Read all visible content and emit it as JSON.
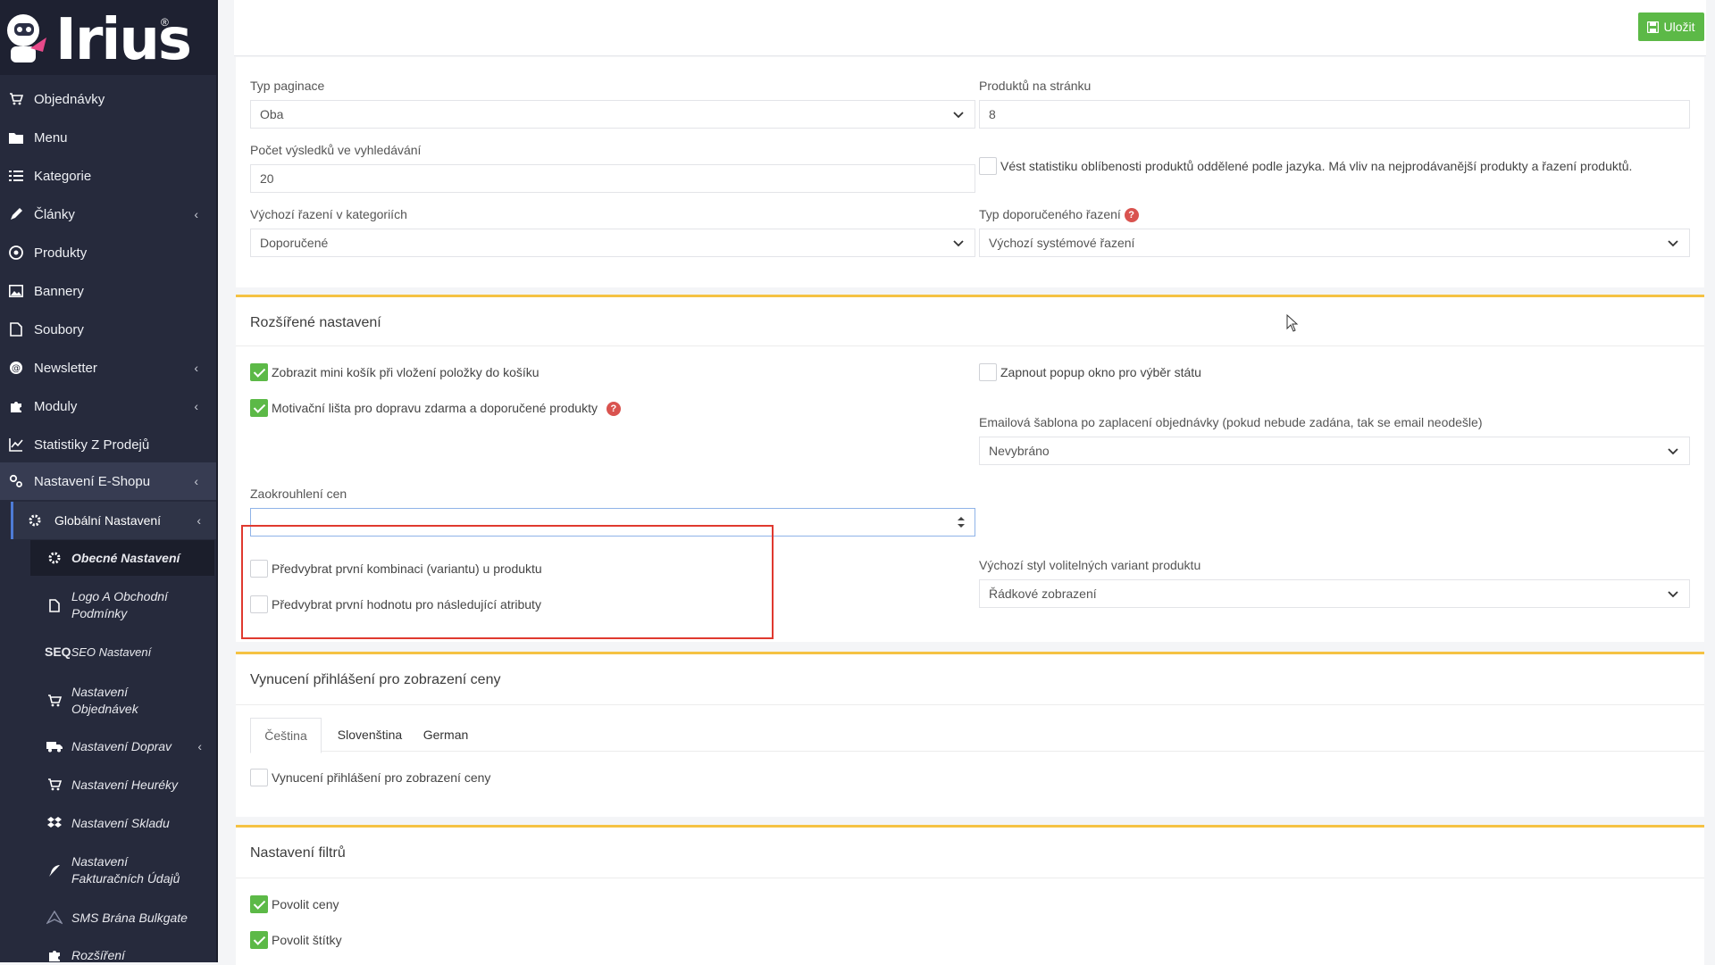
{
  "brand": {
    "name": "Irius",
    "reg": "®"
  },
  "sidebar": {
    "items": [
      {
        "label": "Objednávky",
        "icon": "cart-icon"
      },
      {
        "label": "Menu",
        "icon": "folder-icon"
      },
      {
        "label": "Kategorie",
        "icon": "list-icon"
      },
      {
        "label": "Články",
        "icon": "pencil-icon",
        "chevron": "‹"
      },
      {
        "label": "Produkty",
        "icon": "aperture-icon"
      },
      {
        "label": "Bannery",
        "icon": "image-icon"
      },
      {
        "label": "Soubory",
        "icon": "file-icon"
      },
      {
        "label": "Newsletter",
        "icon": "mail-icon",
        "chevron": "‹"
      },
      {
        "label": "Moduly",
        "icon": "puzzle-icon",
        "chevron": "‹"
      },
      {
        "label": "Statistiky Z Prodejů",
        "icon": "chart-icon"
      },
      {
        "label": "Nastavení E-Shopu",
        "icon": "settings-icon",
        "chevron": "‹"
      }
    ],
    "sub": {
      "label": "Globální Nastavení",
      "chevron": "‹"
    },
    "sub2": [
      {
        "label": "Obecné Nastavení",
        "icon": "gear-icon"
      },
      {
        "label": "Logo A Obchodní Podmínky",
        "icon": "file-icon"
      },
      {
        "label": "SEO Nastavení",
        "icon": "seo-icon",
        "icon_text": "SEQ"
      },
      {
        "label": "Nastavení Objednávek",
        "icon": "cart-icon"
      },
      {
        "label": "Nastavení Doprav",
        "icon": "truck-icon",
        "chevron": "‹"
      },
      {
        "label": "Nastavení Heuréky",
        "icon": "cart-icon"
      },
      {
        "label": "Nastavení Skladu",
        "icon": "dropbox-icon"
      },
      {
        "label": "Nastavení Fakturačních Údajů",
        "icon": "feather-icon"
      },
      {
        "label": "SMS Brána Bulkgate",
        "icon": "paperplane-icon"
      },
      {
        "label": "Rozšíření",
        "icon": "puzzle-icon"
      }
    ]
  },
  "toolbar": {
    "save_label": "Uložit"
  },
  "general": {
    "pagination_label": "Typ paginace",
    "pagination_value": "Oba",
    "per_page_label": "Produktů na stránku",
    "per_page_value": "8",
    "search_results_label": "Počet výsledků ve vyhledávání",
    "search_results_value": "20",
    "stats_text": "Vést statistiku oblíbenosti produktů oddělené podle jazyka. Má vliv na nejprodávanější produkty a řazení produktů.",
    "sort_label": "Výchozí řazení v kategoriích",
    "sort_value": "Doporučené",
    "rec_sort_label": "Typ doporučeného řazení",
    "rec_sort_value": "Výchozí systémové řazení"
  },
  "advanced": {
    "title": "Rozšířené nastavení",
    "mini_cart": "Zobrazit mini košík při vložení položky do košíku",
    "motivation": "Motivační lišta pro dopravu zdarma a doporučené produkty",
    "popup": "Zapnout popup okno pro výběr státu",
    "email_tpl_label": "Emailová šablona po zaplacení objednávky (pokud nebude zadána, tak se email neodešle)",
    "email_tpl_value": "Nevybráno",
    "rounding_label": "Zaokrouhlení cen",
    "rounding_value": "",
    "preselect_combination": "Předvybrat první kombinaci (variantu) u produktu",
    "preselect_value": "Předvybrat první hodnotu pro následující atributy",
    "variant_style_label": "Výchozí styl volitelných variant produktu",
    "variant_style_value": "Řádkové zobrazení"
  },
  "login": {
    "title": "Vynucení přihlášení pro zobrazení ceny",
    "tabs": [
      "Čeština",
      "Slovenština",
      "German"
    ],
    "checkbox": "Vynucení přihlášení pro zobrazení ceny"
  },
  "filters": {
    "title": "Nastavení filtrů",
    "prices": "Povolit ceny",
    "tags": "Povolit štítky"
  },
  "colors": {
    "accent": "#f5c243",
    "success": "#5cb947",
    "sidebar": "#262a3c",
    "highlight": "#e0392f"
  }
}
